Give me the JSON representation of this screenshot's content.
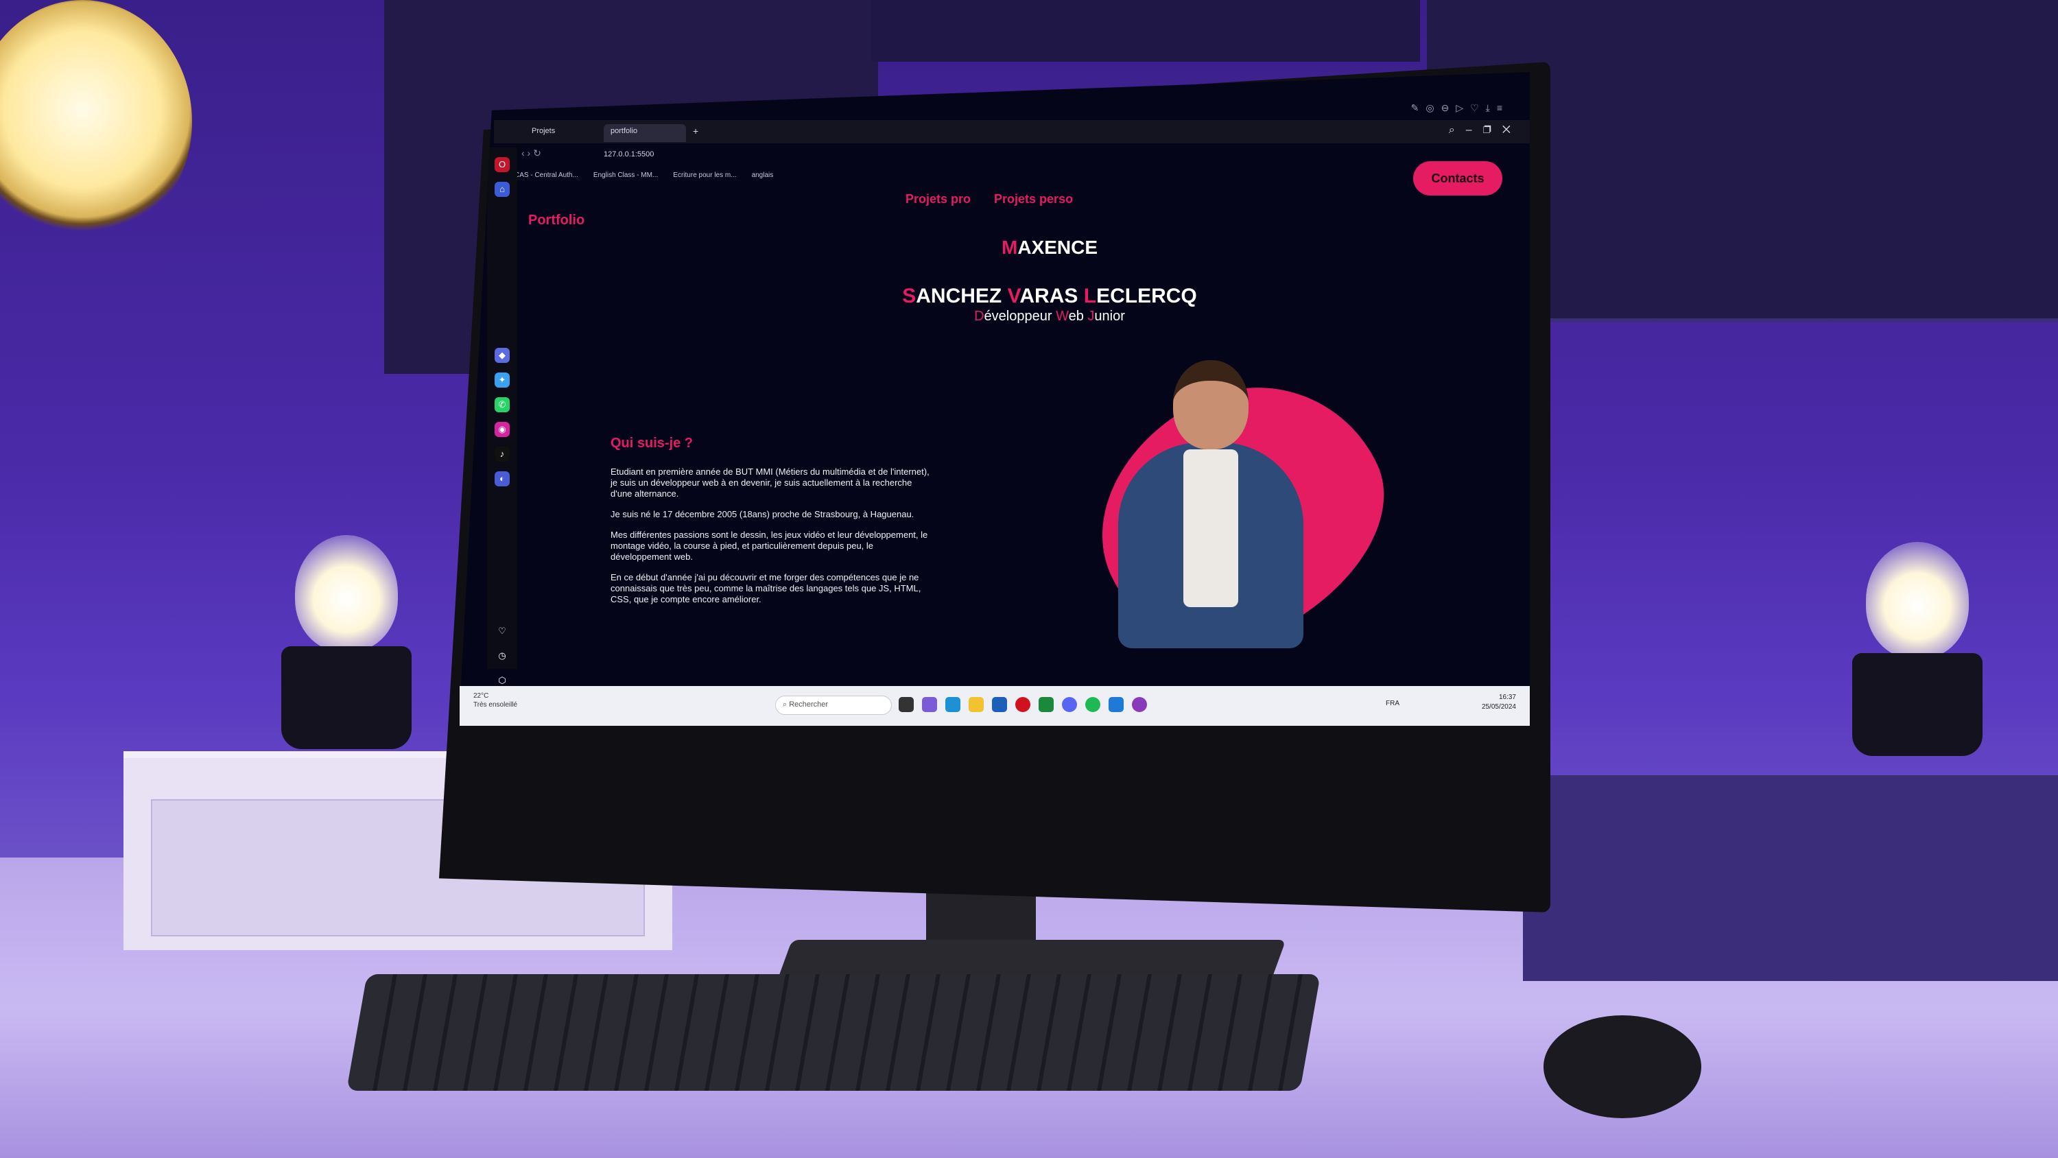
{
  "browser": {
    "tabs": [
      {
        "label": "Projets"
      },
      {
        "label": "portfolio"
      }
    ],
    "new_tab": "+",
    "url": "127.0.0.1:5500",
    "bookmarks": [
      "CAS - Central Auth...",
      "English Class - MM...",
      "Ecriture pour les m...",
      "anglais"
    ]
  },
  "site": {
    "brand": "Portfolio",
    "nav": [
      "Projets pro",
      "Projets perso"
    ],
    "contacts_button": "Contacts",
    "first_name_initial": "M",
    "first_name_rest": "AXENCE",
    "last_name_parts": [
      {
        "initial": "S",
        "rest": "ANCHEZ "
      },
      {
        "initial": "V",
        "rest": "ARAS "
      },
      {
        "initial": "L",
        "rest": "ECLERCQ"
      }
    ],
    "role_parts": [
      {
        "initial": "D",
        "rest": "éveloppeur "
      },
      {
        "initial": "W",
        "rest": "eb "
      },
      {
        "initial": "J",
        "rest": "unior"
      }
    ],
    "about_title": "Qui suis-je ?",
    "about_paragraphs": [
      "Etudiant en première année de BUT MMI (Métiers du multimédia et de l'internet), je suis un développeur web à en devenir, je suis actuellement à la recherche d'une alternance.",
      "Je suis né le 17 décembre 2005 (18ans) proche de Strasbourg, à Haguenau.",
      "Mes différentes passions sont le dessin, les jeux vidéo et leur développement, le montage vidéo, la course à pied, et particulièrement depuis peu, le développement web.",
      "En ce début d'année j'ai pu découvrir et me forger des compétences que je ne connaissais que très peu, comme la maîtrise des langages tels que JS, HTML, CSS, que je compte encore améliorer."
    ],
    "accent_color": "#e51c62"
  },
  "taskbar": {
    "weather_temp": "22°C",
    "weather_desc": "Très ensoleillé",
    "search_placeholder": "Rechercher",
    "language": "FRA",
    "time": "16:37",
    "date": "25/05/2024"
  }
}
